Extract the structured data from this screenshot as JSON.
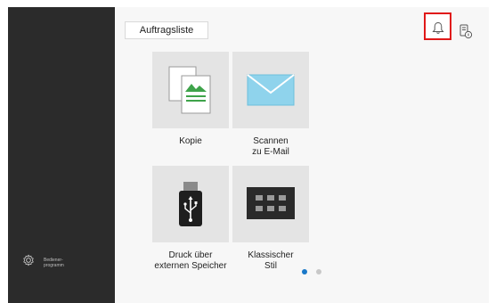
{
  "toolbar": {
    "job_list_label": "Auftragsliste"
  },
  "icons": {
    "notifications": "bell-icon",
    "device_info": "device-info-icon",
    "admin": "gear-icon"
  },
  "tiles": [
    {
      "label": "Kopie",
      "icon": "copy-icon"
    },
    {
      "label": "Scannen\nzu E-Mail",
      "icon": "email-envelope-icon"
    },
    {
      "label": "Druck über\nexternen Speicher",
      "icon": "usb-drive-icon"
    },
    {
      "label": "Klassischer\nStil",
      "icon": "keypad-icon"
    }
  ],
  "sidebar": {
    "admin_label": "Bediener-\nprogramm"
  },
  "pagination": {
    "current_page": 1,
    "total_pages": 2
  },
  "colors": {
    "highlight": "#e01818",
    "active_dot": "#1a78c8",
    "inactive_dot": "#c8c8c8",
    "sidebar": "#2b2b2b"
  }
}
